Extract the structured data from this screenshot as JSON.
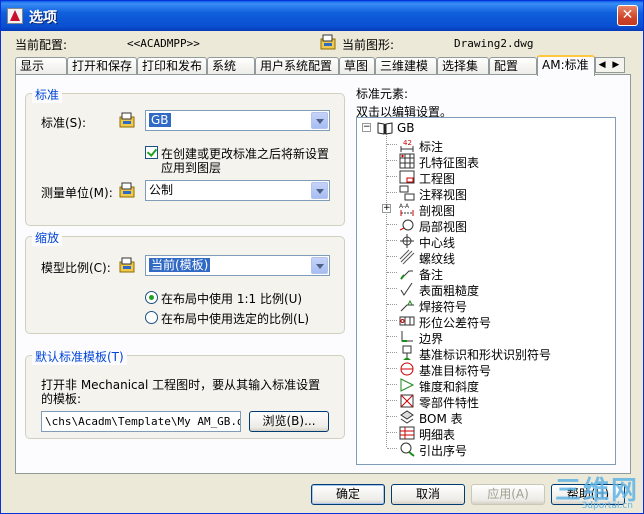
{
  "window": {
    "title": "选项",
    "close_label": "✕"
  },
  "header": {
    "current_profile_label": "当前配置:",
    "current_profile_value": "<<ACADMPP>>",
    "current_drawing_label": "当前图形:",
    "current_drawing_value": "Drawing2.dwg"
  },
  "tabs": [
    {
      "label": "显示"
    },
    {
      "label": "打开和保存"
    },
    {
      "label": "打印和发布"
    },
    {
      "label": "系统"
    },
    {
      "label": "用户系统配置"
    },
    {
      "label": "草图"
    },
    {
      "label": "三维建模"
    },
    {
      "label": "选择集"
    },
    {
      "label": "配置"
    },
    {
      "label": "AM:标准",
      "active": true
    }
  ],
  "tab_scroll_label": "◀ ▶",
  "standard_group": {
    "title": "标准",
    "standard_label": "标准(S):",
    "standard_value": "GB",
    "update_checkbox_label_line1": "在创建或更改标准之后将新设置",
    "update_checkbox_label_line2": "应用到图层",
    "update_checked": true,
    "units_label": "测量单位(M):",
    "units_value": "公制"
  },
  "scale_group": {
    "title": "缩放",
    "model_scale_label": "模型比例(C):",
    "model_scale_value": "当前(模板)",
    "radio_layout_1to1": "在布局中使用 1:1 比例(U)",
    "radio_layout_selected": "在布局中使用选定的比例(L)",
    "selected_radio": "layout_1to1"
  },
  "template_group": {
    "title": "默认标准模板(T)",
    "description_line1": "打开非 Mechanical 工程图时，要从其输入标准设置",
    "description_line2": "的模板:",
    "path_value": "\\chs\\Acadm\\Template\\My AM_GB.dwt",
    "browse_button": "浏览(B)..."
  },
  "tree": {
    "section_label": "标准元素:",
    "hint": "双击以编辑设置。",
    "root_label": "GB",
    "root_expander": "−",
    "items": [
      {
        "label": "标注",
        "icon": "dimension-icon"
      },
      {
        "label": "孔特征图表",
        "icon": "hole-chart-icon"
      },
      {
        "label": "工程图",
        "icon": "drawing-icon"
      },
      {
        "label": "注释视图",
        "icon": "annotation-view-icon"
      },
      {
        "label": "剖视图",
        "icon": "section-view-icon",
        "expander": "+"
      },
      {
        "label": "局部视图",
        "icon": "detail-view-icon"
      },
      {
        "label": "中心线",
        "icon": "centerline-icon"
      },
      {
        "label": "螺纹线",
        "icon": "thread-icon"
      },
      {
        "label": "备注",
        "icon": "note-icon"
      },
      {
        "label": "表面粗糙度",
        "icon": "surface-texture-icon"
      },
      {
        "label": "焊接符号",
        "icon": "weld-symbol-icon"
      },
      {
        "label": "形位公差符号",
        "icon": "tolerance-icon"
      },
      {
        "label": "边界",
        "icon": "edge-icon"
      },
      {
        "label": "基准标识和形状识别符号",
        "icon": "datum-identifier-icon"
      },
      {
        "label": "基准目标符号",
        "icon": "datum-target-icon"
      },
      {
        "label": "锥度和斜度",
        "icon": "taper-slope-icon"
      },
      {
        "label": "零部件特性",
        "icon": "part-property-icon"
      },
      {
        "label": "BOM 表",
        "icon": "bom-icon"
      },
      {
        "label": "明细表",
        "icon": "parts-list-icon"
      },
      {
        "label": "引出序号",
        "icon": "balloon-icon"
      }
    ]
  },
  "footer": {
    "ok": "确定",
    "cancel": "取消",
    "apply": "应用(A)",
    "help": "帮助(H)"
  },
  "watermark": {
    "text": "三维网",
    "sub": "3dportal.cn"
  },
  "colors": {
    "title_bar": "#0a4fcf",
    "group_title": "#0046d5",
    "selection": "#316ac5",
    "check": "#21a121"
  }
}
